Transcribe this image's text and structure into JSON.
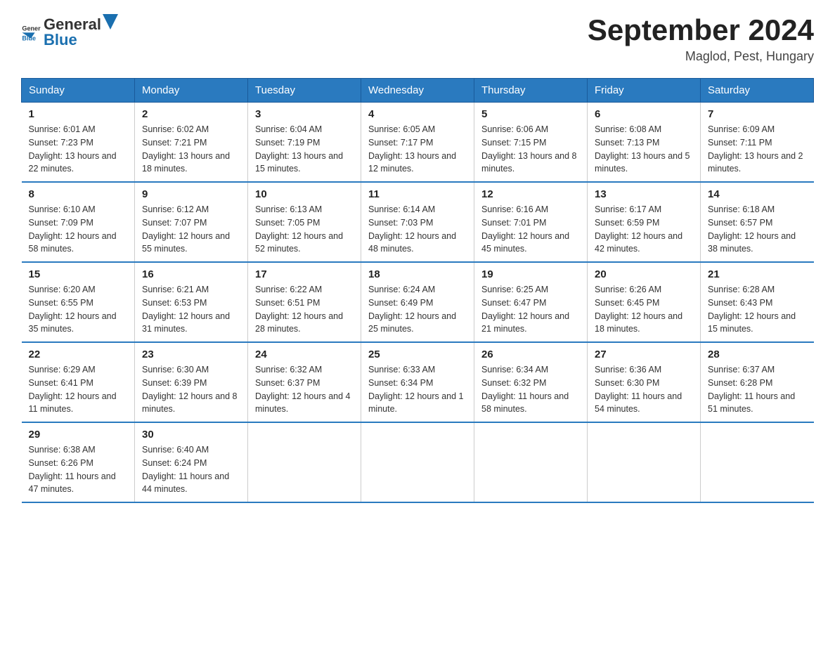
{
  "logo": {
    "text_general": "General",
    "text_blue": "Blue"
  },
  "header": {
    "title": "September 2024",
    "subtitle": "Maglod, Pest, Hungary"
  },
  "days_of_week": [
    "Sunday",
    "Monday",
    "Tuesday",
    "Wednesday",
    "Thursday",
    "Friday",
    "Saturday"
  ],
  "weeks": [
    [
      {
        "day": "1",
        "sunrise": "6:01 AM",
        "sunset": "7:23 PM",
        "daylight": "13 hours and 22 minutes."
      },
      {
        "day": "2",
        "sunrise": "6:02 AM",
        "sunset": "7:21 PM",
        "daylight": "13 hours and 18 minutes."
      },
      {
        "day": "3",
        "sunrise": "6:04 AM",
        "sunset": "7:19 PM",
        "daylight": "13 hours and 15 minutes."
      },
      {
        "day": "4",
        "sunrise": "6:05 AM",
        "sunset": "7:17 PM",
        "daylight": "13 hours and 12 minutes."
      },
      {
        "day": "5",
        "sunrise": "6:06 AM",
        "sunset": "7:15 PM",
        "daylight": "13 hours and 8 minutes."
      },
      {
        "day": "6",
        "sunrise": "6:08 AM",
        "sunset": "7:13 PM",
        "daylight": "13 hours and 5 minutes."
      },
      {
        "day": "7",
        "sunrise": "6:09 AM",
        "sunset": "7:11 PM",
        "daylight": "13 hours and 2 minutes."
      }
    ],
    [
      {
        "day": "8",
        "sunrise": "6:10 AM",
        "sunset": "7:09 PM",
        "daylight": "12 hours and 58 minutes."
      },
      {
        "day": "9",
        "sunrise": "6:12 AM",
        "sunset": "7:07 PM",
        "daylight": "12 hours and 55 minutes."
      },
      {
        "day": "10",
        "sunrise": "6:13 AM",
        "sunset": "7:05 PM",
        "daylight": "12 hours and 52 minutes."
      },
      {
        "day": "11",
        "sunrise": "6:14 AM",
        "sunset": "7:03 PM",
        "daylight": "12 hours and 48 minutes."
      },
      {
        "day": "12",
        "sunrise": "6:16 AM",
        "sunset": "7:01 PM",
        "daylight": "12 hours and 45 minutes."
      },
      {
        "day": "13",
        "sunrise": "6:17 AM",
        "sunset": "6:59 PM",
        "daylight": "12 hours and 42 minutes."
      },
      {
        "day": "14",
        "sunrise": "6:18 AM",
        "sunset": "6:57 PM",
        "daylight": "12 hours and 38 minutes."
      }
    ],
    [
      {
        "day": "15",
        "sunrise": "6:20 AM",
        "sunset": "6:55 PM",
        "daylight": "12 hours and 35 minutes."
      },
      {
        "day": "16",
        "sunrise": "6:21 AM",
        "sunset": "6:53 PM",
        "daylight": "12 hours and 31 minutes."
      },
      {
        "day": "17",
        "sunrise": "6:22 AM",
        "sunset": "6:51 PM",
        "daylight": "12 hours and 28 minutes."
      },
      {
        "day": "18",
        "sunrise": "6:24 AM",
        "sunset": "6:49 PM",
        "daylight": "12 hours and 25 minutes."
      },
      {
        "day": "19",
        "sunrise": "6:25 AM",
        "sunset": "6:47 PM",
        "daylight": "12 hours and 21 minutes."
      },
      {
        "day": "20",
        "sunrise": "6:26 AM",
        "sunset": "6:45 PM",
        "daylight": "12 hours and 18 minutes."
      },
      {
        "day": "21",
        "sunrise": "6:28 AM",
        "sunset": "6:43 PM",
        "daylight": "12 hours and 15 minutes."
      }
    ],
    [
      {
        "day": "22",
        "sunrise": "6:29 AM",
        "sunset": "6:41 PM",
        "daylight": "12 hours and 11 minutes."
      },
      {
        "day": "23",
        "sunrise": "6:30 AM",
        "sunset": "6:39 PM",
        "daylight": "12 hours and 8 minutes."
      },
      {
        "day": "24",
        "sunrise": "6:32 AM",
        "sunset": "6:37 PM",
        "daylight": "12 hours and 4 minutes."
      },
      {
        "day": "25",
        "sunrise": "6:33 AM",
        "sunset": "6:34 PM",
        "daylight": "12 hours and 1 minute."
      },
      {
        "day": "26",
        "sunrise": "6:34 AM",
        "sunset": "6:32 PM",
        "daylight": "11 hours and 58 minutes."
      },
      {
        "day": "27",
        "sunrise": "6:36 AM",
        "sunset": "6:30 PM",
        "daylight": "11 hours and 54 minutes."
      },
      {
        "day": "28",
        "sunrise": "6:37 AM",
        "sunset": "6:28 PM",
        "daylight": "11 hours and 51 minutes."
      }
    ],
    [
      {
        "day": "29",
        "sunrise": "6:38 AM",
        "sunset": "6:26 PM",
        "daylight": "11 hours and 47 minutes."
      },
      {
        "day": "30",
        "sunrise": "6:40 AM",
        "sunset": "6:24 PM",
        "daylight": "11 hours and 44 minutes."
      },
      null,
      null,
      null,
      null,
      null
    ]
  ]
}
